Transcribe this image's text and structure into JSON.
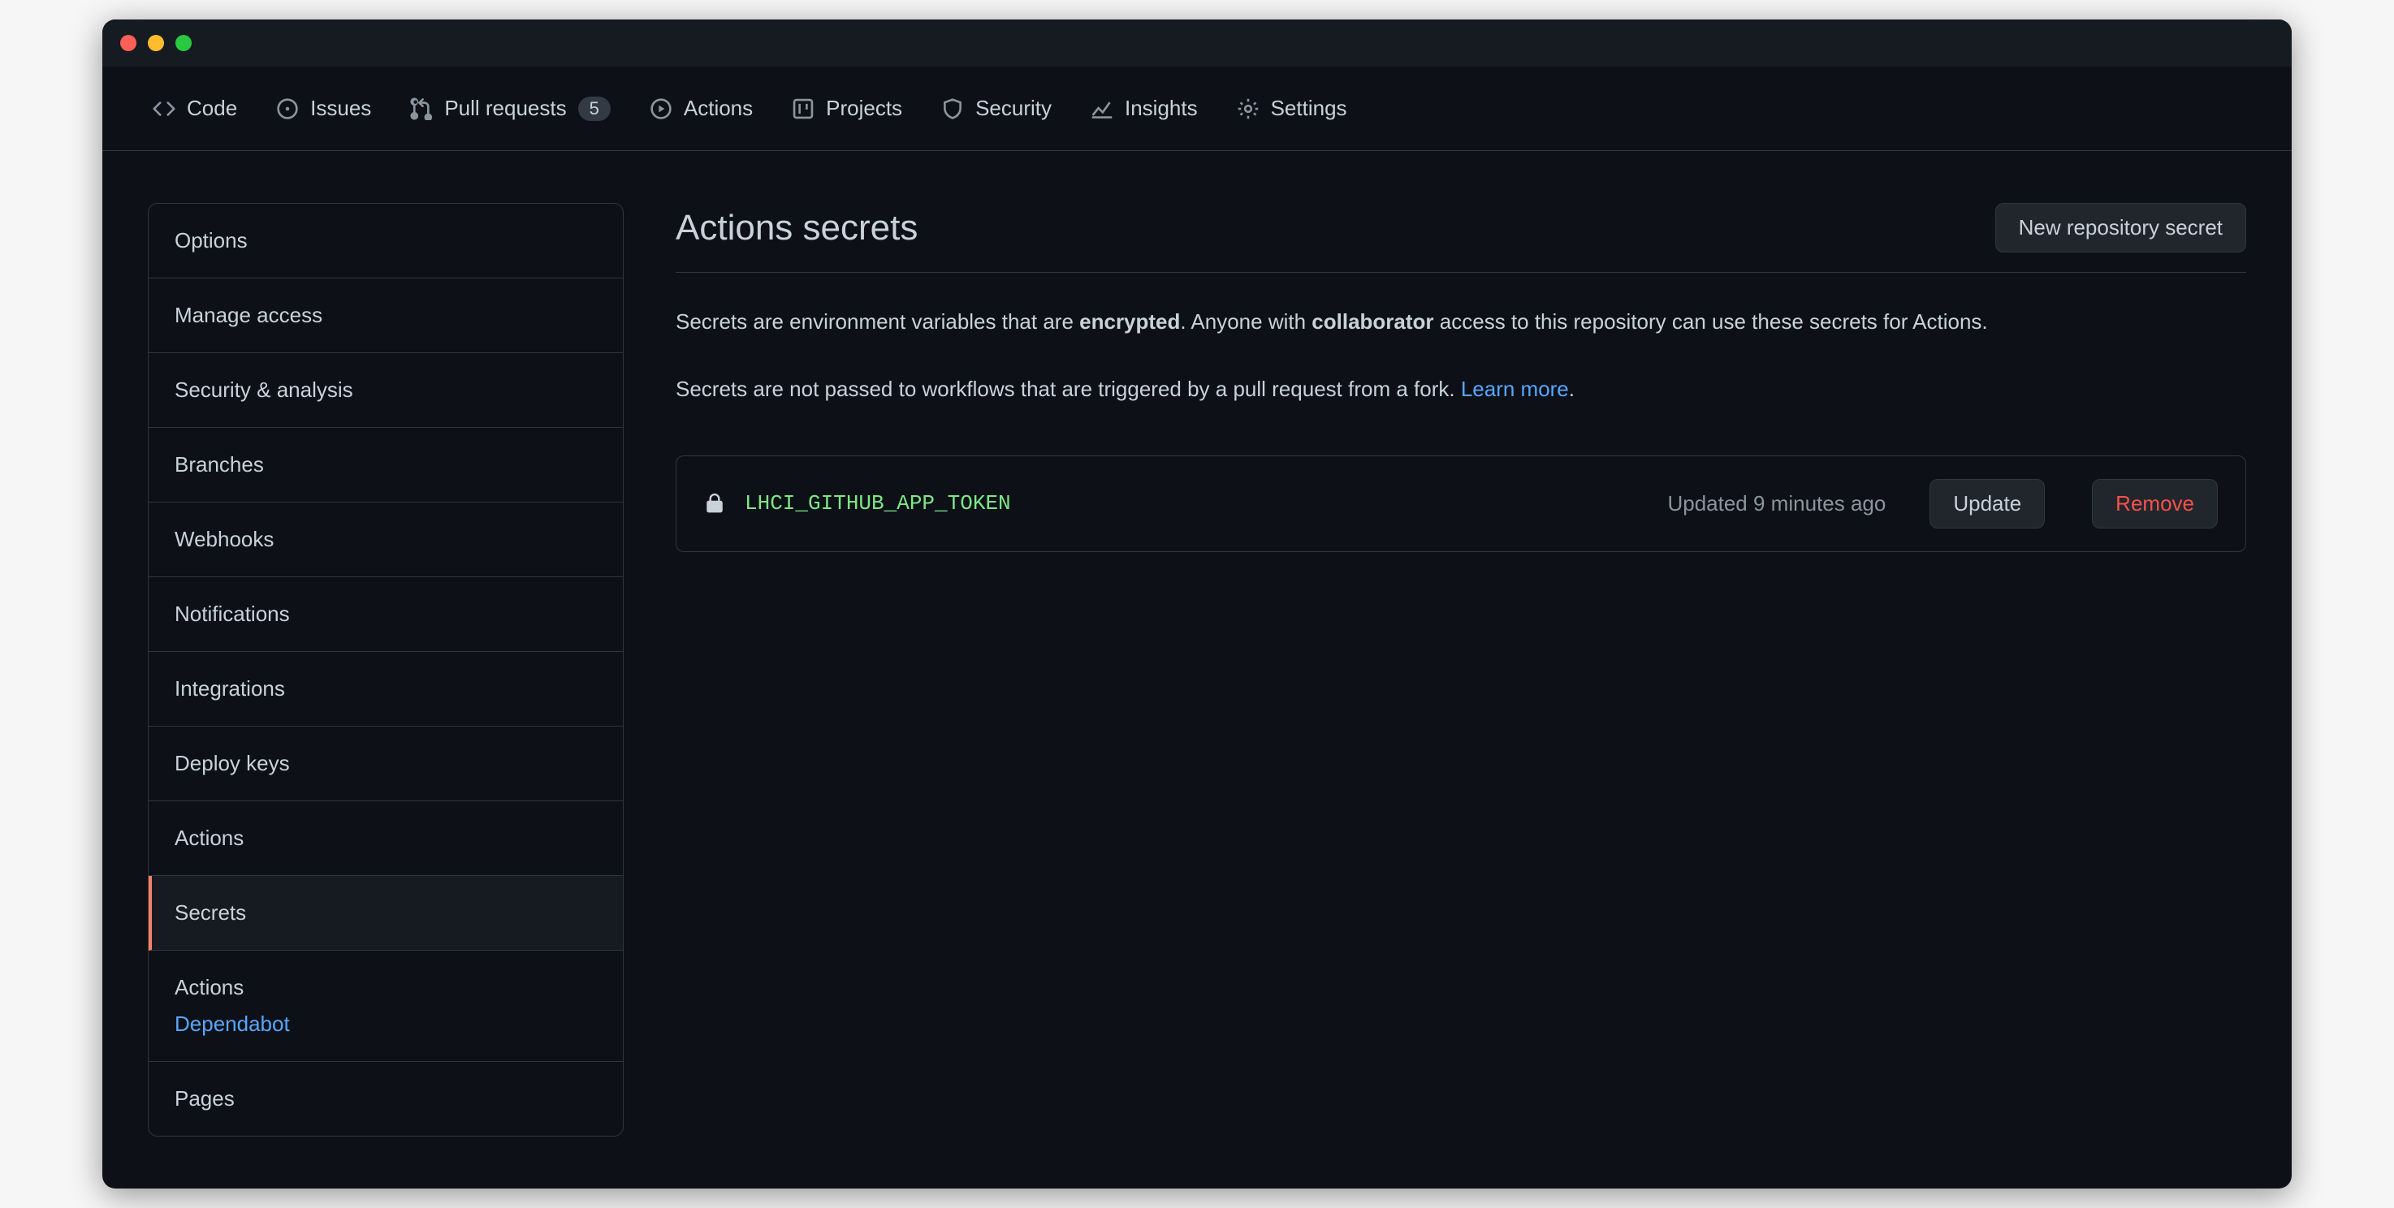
{
  "tabs": {
    "code": "Code",
    "issues": "Issues",
    "pulls": "Pull requests",
    "pulls_count": "5",
    "actions": "Actions",
    "projects": "Projects",
    "security": "Security",
    "insights": "Insights",
    "settings": "Settings"
  },
  "sidebar": {
    "options": "Options",
    "manage_access": "Manage access",
    "security_analysis": "Security & analysis",
    "branches": "Branches",
    "webhooks": "Webhooks",
    "notifications": "Notifications",
    "integrations": "Integrations",
    "deploy_keys": "Deploy keys",
    "actions": "Actions",
    "secrets": "Secrets",
    "sub_actions": "Actions",
    "sub_dependabot": "Dependabot",
    "pages": "Pages"
  },
  "main": {
    "title": "Actions secrets",
    "new_secret": "New repository secret",
    "blurb_1a": "Secrets are environment variables that are ",
    "blurb_1b": "encrypted",
    "blurb_1c": ". Anyone with ",
    "blurb_1d": "collaborator",
    "blurb_1e": " access to this repository can use these secrets for Actions.",
    "blurb_2a": "Secrets are not passed to workflows that are triggered by a pull request from a fork. ",
    "blurb_2b": "Learn more",
    "blurb_2c": "."
  },
  "secret": {
    "name": "LHCI_GITHUB_APP_TOKEN",
    "updated": "Updated 9 minutes ago",
    "update_btn": "Update",
    "remove_btn": "Remove"
  }
}
